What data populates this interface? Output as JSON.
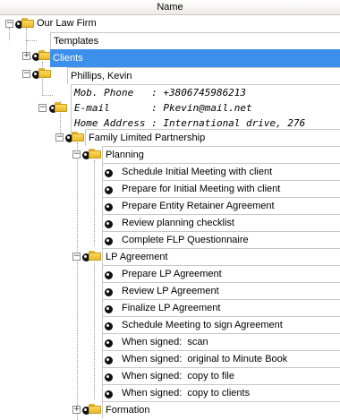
{
  "column_header": "Name",
  "tree": {
    "root_label": "Our Law Firm",
    "templates_label": "Templates",
    "clients_label": "Clients",
    "client_name": "Phillips, Kevin",
    "contact": {
      "mobile": "Mob. Phone   : +3806745986213",
      "email": "E-mail       : Pkevin@mail.net",
      "address": "Home Address : International drive, 276"
    },
    "matter_label": "Family Limited Partnership",
    "planning": {
      "label": "Planning",
      "tasks": [
        "Schedule Initial Meeting with client",
        "Prepare for Initial Meeting with client",
        "Prepare Entity Retainer Agreement",
        "Review planning checklist",
        "Complete FLP Questionnaire"
      ]
    },
    "lp_agreement": {
      "label": "LP Agreement",
      "tasks": [
        "Prepare LP Agreement",
        "Review LP Agreement",
        "Finalize LP Agreement",
        "Schedule Meeting to sign Agreement",
        "When signed:  scan",
        "When signed:  original to Minute Book",
        "When signed:  copy to file",
        "When signed:  copy to clients"
      ]
    },
    "formation_label": "Formation"
  },
  "colors": {
    "selection": "#3c8fea",
    "folder": "#f5c842"
  }
}
